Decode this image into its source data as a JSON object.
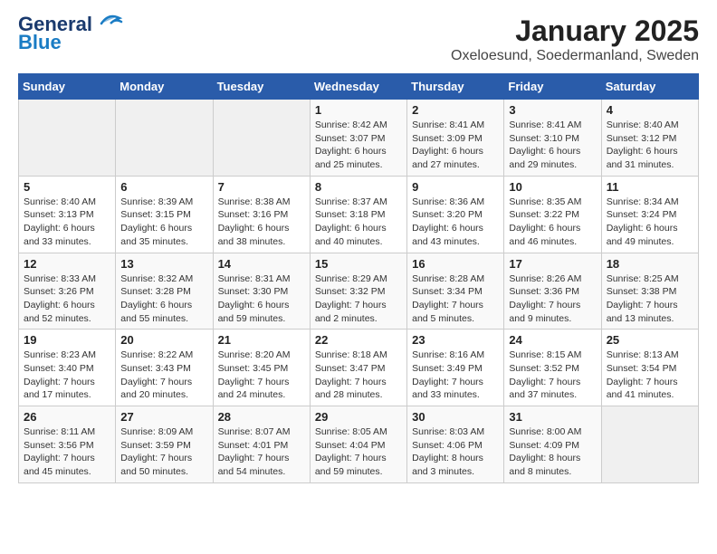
{
  "logo": {
    "line1": "General",
    "line2": "Blue"
  },
  "title": "January 2025",
  "subtitle": "Oxeloesund, Soedermanland, Sweden",
  "weekdays": [
    "Sunday",
    "Monday",
    "Tuesday",
    "Wednesday",
    "Thursday",
    "Friday",
    "Saturday"
  ],
  "weeks": [
    [
      {
        "day": "",
        "info": ""
      },
      {
        "day": "",
        "info": ""
      },
      {
        "day": "",
        "info": ""
      },
      {
        "day": "1",
        "info": "Sunrise: 8:42 AM\nSunset: 3:07 PM\nDaylight: 6 hours\nand 25 minutes."
      },
      {
        "day": "2",
        "info": "Sunrise: 8:41 AM\nSunset: 3:09 PM\nDaylight: 6 hours\nand 27 minutes."
      },
      {
        "day": "3",
        "info": "Sunrise: 8:41 AM\nSunset: 3:10 PM\nDaylight: 6 hours\nand 29 minutes."
      },
      {
        "day": "4",
        "info": "Sunrise: 8:40 AM\nSunset: 3:12 PM\nDaylight: 6 hours\nand 31 minutes."
      }
    ],
    [
      {
        "day": "5",
        "info": "Sunrise: 8:40 AM\nSunset: 3:13 PM\nDaylight: 6 hours\nand 33 minutes."
      },
      {
        "day": "6",
        "info": "Sunrise: 8:39 AM\nSunset: 3:15 PM\nDaylight: 6 hours\nand 35 minutes."
      },
      {
        "day": "7",
        "info": "Sunrise: 8:38 AM\nSunset: 3:16 PM\nDaylight: 6 hours\nand 38 minutes."
      },
      {
        "day": "8",
        "info": "Sunrise: 8:37 AM\nSunset: 3:18 PM\nDaylight: 6 hours\nand 40 minutes."
      },
      {
        "day": "9",
        "info": "Sunrise: 8:36 AM\nSunset: 3:20 PM\nDaylight: 6 hours\nand 43 minutes."
      },
      {
        "day": "10",
        "info": "Sunrise: 8:35 AM\nSunset: 3:22 PM\nDaylight: 6 hours\nand 46 minutes."
      },
      {
        "day": "11",
        "info": "Sunrise: 8:34 AM\nSunset: 3:24 PM\nDaylight: 6 hours\nand 49 minutes."
      }
    ],
    [
      {
        "day": "12",
        "info": "Sunrise: 8:33 AM\nSunset: 3:26 PM\nDaylight: 6 hours\nand 52 minutes."
      },
      {
        "day": "13",
        "info": "Sunrise: 8:32 AM\nSunset: 3:28 PM\nDaylight: 6 hours\nand 55 minutes."
      },
      {
        "day": "14",
        "info": "Sunrise: 8:31 AM\nSunset: 3:30 PM\nDaylight: 6 hours\nand 59 minutes."
      },
      {
        "day": "15",
        "info": "Sunrise: 8:29 AM\nSunset: 3:32 PM\nDaylight: 7 hours\nand 2 minutes."
      },
      {
        "day": "16",
        "info": "Sunrise: 8:28 AM\nSunset: 3:34 PM\nDaylight: 7 hours\nand 5 minutes."
      },
      {
        "day": "17",
        "info": "Sunrise: 8:26 AM\nSunset: 3:36 PM\nDaylight: 7 hours\nand 9 minutes."
      },
      {
        "day": "18",
        "info": "Sunrise: 8:25 AM\nSunset: 3:38 PM\nDaylight: 7 hours\nand 13 minutes."
      }
    ],
    [
      {
        "day": "19",
        "info": "Sunrise: 8:23 AM\nSunset: 3:40 PM\nDaylight: 7 hours\nand 17 minutes."
      },
      {
        "day": "20",
        "info": "Sunrise: 8:22 AM\nSunset: 3:43 PM\nDaylight: 7 hours\nand 20 minutes."
      },
      {
        "day": "21",
        "info": "Sunrise: 8:20 AM\nSunset: 3:45 PM\nDaylight: 7 hours\nand 24 minutes."
      },
      {
        "day": "22",
        "info": "Sunrise: 8:18 AM\nSunset: 3:47 PM\nDaylight: 7 hours\nand 28 minutes."
      },
      {
        "day": "23",
        "info": "Sunrise: 8:16 AM\nSunset: 3:49 PM\nDaylight: 7 hours\nand 33 minutes."
      },
      {
        "day": "24",
        "info": "Sunrise: 8:15 AM\nSunset: 3:52 PM\nDaylight: 7 hours\nand 37 minutes."
      },
      {
        "day": "25",
        "info": "Sunrise: 8:13 AM\nSunset: 3:54 PM\nDaylight: 7 hours\nand 41 minutes."
      }
    ],
    [
      {
        "day": "26",
        "info": "Sunrise: 8:11 AM\nSunset: 3:56 PM\nDaylight: 7 hours\nand 45 minutes."
      },
      {
        "day": "27",
        "info": "Sunrise: 8:09 AM\nSunset: 3:59 PM\nDaylight: 7 hours\nand 50 minutes."
      },
      {
        "day": "28",
        "info": "Sunrise: 8:07 AM\nSunset: 4:01 PM\nDaylight: 7 hours\nand 54 minutes."
      },
      {
        "day": "29",
        "info": "Sunrise: 8:05 AM\nSunset: 4:04 PM\nDaylight: 7 hours\nand 59 minutes."
      },
      {
        "day": "30",
        "info": "Sunrise: 8:03 AM\nSunset: 4:06 PM\nDaylight: 8 hours\nand 3 minutes."
      },
      {
        "day": "31",
        "info": "Sunrise: 8:00 AM\nSunset: 4:09 PM\nDaylight: 8 hours\nand 8 minutes."
      },
      {
        "day": "",
        "info": ""
      }
    ]
  ]
}
